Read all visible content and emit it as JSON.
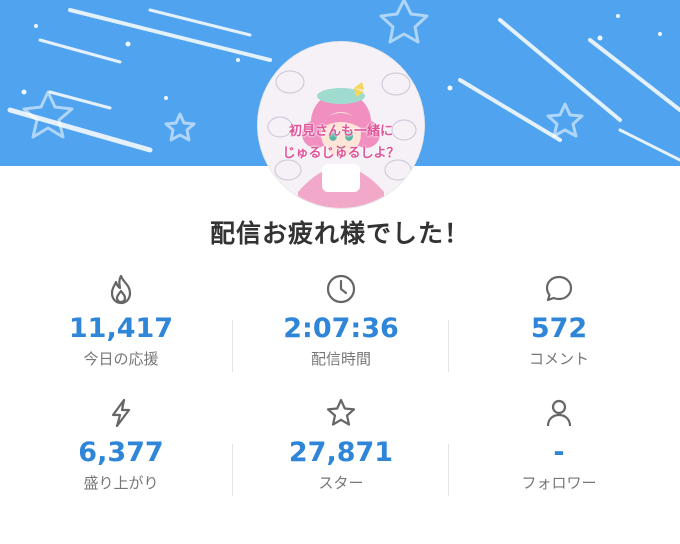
{
  "header": {
    "avatar_caption_line1": "初見さんも一緒に",
    "avatar_caption_line2": "じゅるじゅるしよ？"
  },
  "title": "配信お疲れ様でした！",
  "stats": [
    {
      "icon": "flame-icon",
      "value": "11,417",
      "label": "今日の応援"
    },
    {
      "icon": "clock-icon",
      "value": "2:07:36",
      "label": "配信時間"
    },
    {
      "icon": "comment-bubble-icon",
      "value": "572",
      "label": "コメント"
    },
    {
      "icon": "lightning-icon",
      "value": "6,377",
      "label": "盛り上がり"
    },
    {
      "icon": "star-icon",
      "value": "27,871",
      "label": "スター"
    },
    {
      "icon": "person-icon",
      "value": "-",
      "label": "フォロワー"
    }
  ],
  "colors": {
    "banner": "#4fa3ef",
    "value_text": "#2f86d9",
    "label_text": "#777777",
    "title_text": "#333333",
    "icon_stroke": "#666666"
  }
}
